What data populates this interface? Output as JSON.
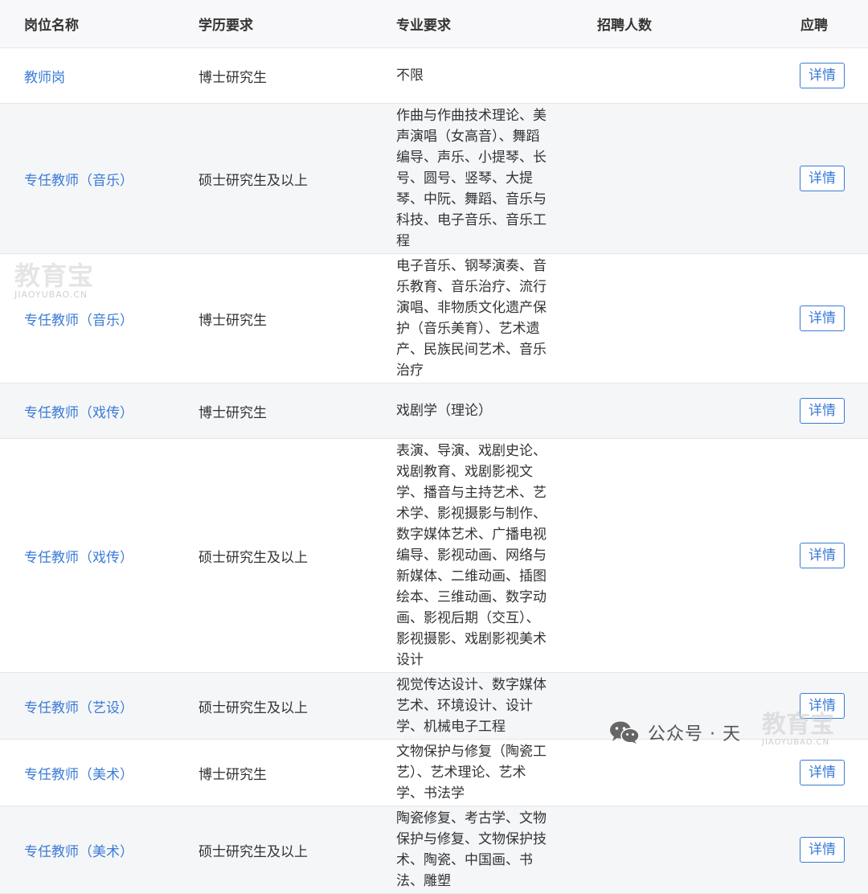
{
  "header": {
    "col_position": "岗位名称",
    "col_education": "学历要求",
    "col_major": "专业要求",
    "col_count": "招聘人数",
    "col_apply": "应聘"
  },
  "rows": [
    {
      "position": "教师岗",
      "education": "博士研究生",
      "major": "不限",
      "count": "",
      "button": "详情"
    },
    {
      "position": "专任教师（音乐）",
      "education": "硕士研究生及以上",
      "major": "作曲与作曲技术理论、美声演唱（女高音）、舞蹈编导、声乐、小提琴、长号、圆号、竖琴、大提琴、中阮、舞蹈、音乐与科技、电子音乐、音乐工程",
      "count": "",
      "button": "详情"
    },
    {
      "position": "专任教师（音乐）",
      "education": "博士研究生",
      "major": "电子音乐、钢琴演奏、音乐教育、音乐治疗、流行演唱、非物质文化遗产保护（音乐美育）、艺术遗产、民族民间艺术、音乐治疗",
      "count": "",
      "button": "详情"
    },
    {
      "position": "专任教师（戏传）",
      "education": "博士研究生",
      "major": "戏剧学（理论）",
      "count": "",
      "button": "详情"
    },
    {
      "position": "专任教师（戏传）",
      "education": "硕士研究生及以上",
      "major": "表演、导演、戏剧史论、戏剧教育、戏剧影视文学、播音与主持艺术、艺术学、影视摄影与制作、数字媒体艺术、广播电视编导、影视动画、网络与新媒体、二维动画、插图绘本、三维动画、数字动画、影视后期（交互）、影视摄影、戏剧影视美术设计",
      "count": "",
      "button": "详情"
    },
    {
      "position": "专任教师（艺设）",
      "education": "硕士研究生及以上",
      "major": "视觉传达设计、数字媒体艺术、环境设计、设计学、机械电子工程",
      "count": "",
      "button": "详情"
    },
    {
      "position": "专任教师（美术）",
      "education": "博士研究生",
      "major": "文物保护与修复（陶瓷工艺）、艺术理论、艺术学、书法学",
      "count": "",
      "button": "详情"
    },
    {
      "position": "专任教师（美术）",
      "education": "硕士研究生及以上",
      "major": "陶瓷修复、考古学、文物保护与修复、文物保护技术、陶瓷、中国画、书法、雕塑",
      "count": "",
      "button": "详情"
    }
  ],
  "watermarks": {
    "left_big": "教育宝",
    "left_small": "JIAOYUBAO.CN",
    "wechat_label": "公众号 · 天",
    "right_big": "教育宝",
    "right_small": "JIAOYUBAO.CN",
    "wechat_icon": "wechat-icon"
  }
}
